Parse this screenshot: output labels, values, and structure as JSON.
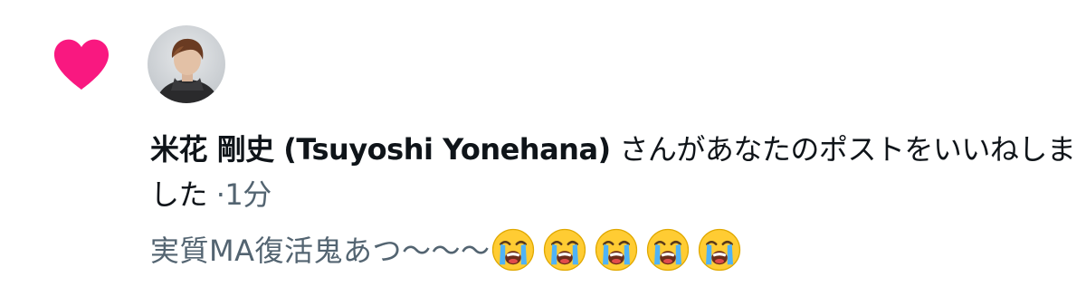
{
  "notification": {
    "type": "like",
    "icon": "heart-icon",
    "accent_color": "#f91880",
    "avatar": "user-avatar-photo",
    "actor_name": "米花 剛史 (Tsuyoshi Yonehana)",
    "action_text": "さんがあなたのポストをいいねしました",
    "separator": "·",
    "timestamp": "1分",
    "post_preview": "実質MA復活鬼あつ〜〜〜",
    "preview_emojis": [
      "loudly-crying-face-emoji",
      "loudly-crying-face-emoji",
      "loudly-crying-face-emoji",
      "loudly-crying-face-emoji",
      "loudly-crying-face-emoji"
    ]
  }
}
